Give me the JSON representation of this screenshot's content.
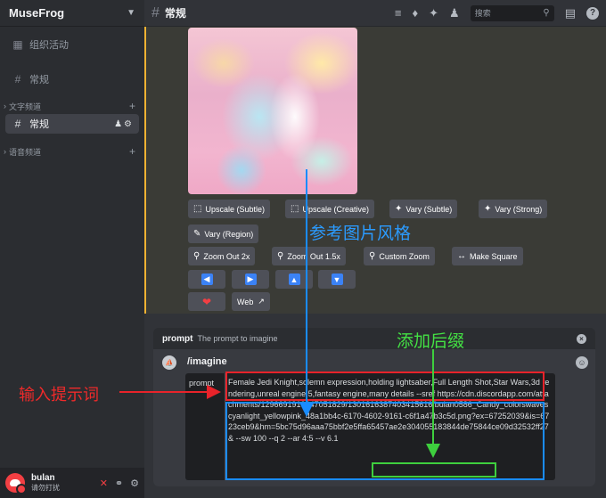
{
  "server": {
    "name": "MuseFrog"
  },
  "sidebar": {
    "event_label": "组织活动",
    "general_top": "常规",
    "text_category": "文字频道",
    "active_channel": "常规",
    "voice_category": "语音频道"
  },
  "user": {
    "name": "bulan",
    "status": "请勿打扰"
  },
  "topbar": {
    "channel": "常规",
    "search_placeholder": "搜索"
  },
  "buttons": {
    "upscale_subtle": "Upscale (Subtle)",
    "upscale_creative": "Upscale (Creative)",
    "vary_subtle": "Vary (Subtle)",
    "vary_strong": "Vary (Strong)",
    "vary_region": "Vary (Region)",
    "zoom_out_2x": "Zoom Out 2x",
    "zoom_out_15x": "Zoom Out 1.5x",
    "custom_zoom": "Custom Zoom",
    "make_square": "Make Square",
    "web": "Web"
  },
  "command": {
    "option_name": "prompt",
    "option_desc": "The prompt to imagine",
    "slash": "/imagine",
    "field_label": "prompt",
    "text": "Female Jedi Knight,solemn expression,holding lightsaber,Full Length Shot,Star Wars,3d rendering,unreal engine 5,fantasy engine,many details --sref https://cdn.discordapp.com/attachments/1296691919647051829/1301616387403415616/bulan0586_Candy_colorswavescyanlight_yellowpink_48a1bb4c-6170-4602-9161-c6f1a47b3c5d.png?ex=67252039&is=6723ceb9&hm=5bc75d96aaa75bbf2e5ffa65457ae2e304055183844de75844ce09d32532ff27& --sw 100 --q 2 --ar 4:5 --v 6.1"
  },
  "annotations": {
    "ref_style": "参考图片风格",
    "add_suffix": "添加后缀",
    "enter_prompt": "输入提示词"
  },
  "colors": {
    "annotation_red": "#e8232a",
    "annotation_blue": "#1a8cff",
    "annotation_green": "#3ecf3e",
    "accent_bar": "#f0b232"
  }
}
